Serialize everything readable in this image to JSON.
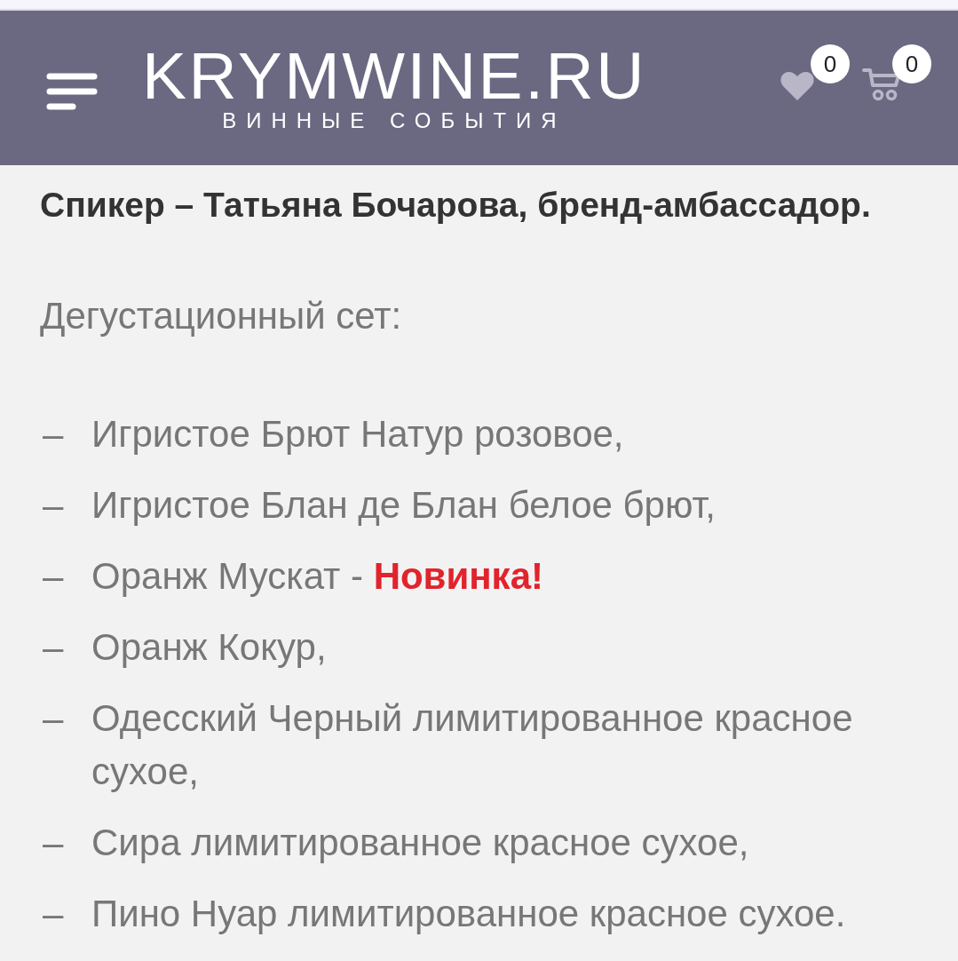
{
  "header": {
    "logo": {
      "title": "KRYMWINE.RU",
      "tagline": "ВИННЫЕ СОБЫТИЯ"
    },
    "wishlist": {
      "count": "0"
    },
    "cart": {
      "count": "0"
    }
  },
  "article": {
    "speaker": "Спикер – Татьяна Бочарова, бренд-амбассадор.",
    "set_title": "Дегустационный сет:",
    "items": [
      {
        "marker": "–",
        "text": "Игристое Брют Натур розовое,"
      },
      {
        "marker": "–",
        "text": "Игристое Блан де Блан белое брют,"
      },
      {
        "marker": "–",
        "text": "Оранж Мускат - **Новинка!**"
      },
      {
        "marker": "–",
        "text": "Оранж Кокур,"
      },
      {
        "marker": "–",
        "text": "Одесский Черный лимитированное красное сухое,"
      },
      {
        "marker": "–",
        "text": "Сира лимитированное красное сухое,"
      },
      {
        "marker": "–",
        "text": "Пино Нуар лимитированное красное сухое."
      }
    ]
  }
}
